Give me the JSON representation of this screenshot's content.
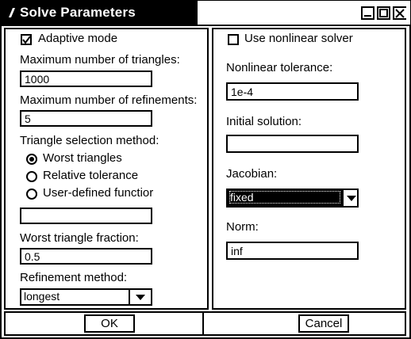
{
  "window": {
    "title": "Solve Parameters"
  },
  "left": {
    "adaptive_mode": {
      "label": "Adaptive mode",
      "checked": true
    },
    "max_triangles": {
      "label": "Maximum number of triangles:",
      "value": "1000"
    },
    "max_refinements": {
      "label": "Maximum number of refinements:",
      "value": "5"
    },
    "selection_method": {
      "label": "Triangle selection method:",
      "options": [
        "Worst triangles",
        "Relative tolerance",
        "User-defined functior"
      ],
      "selected": "Worst triangles"
    },
    "user_function_value": "",
    "worst_fraction": {
      "label": "Worst triangle fraction:",
      "value": "0.5"
    },
    "refinement_method": {
      "label": "Refinement method:",
      "value": "longest"
    }
  },
  "right": {
    "nonlinear_solver": {
      "label": "Use nonlinear solver",
      "checked": false
    },
    "nonlinear_tolerance": {
      "label": "Nonlinear tolerance:",
      "value": "1e-4"
    },
    "initial_solution": {
      "label": "Initial solution:",
      "value": ""
    },
    "jacobian": {
      "label": "Jacobian:",
      "value": "fixed"
    },
    "norm": {
      "label": "Norm:",
      "value": "inf"
    }
  },
  "buttons": {
    "ok": "OK",
    "cancel": "Cancel"
  }
}
